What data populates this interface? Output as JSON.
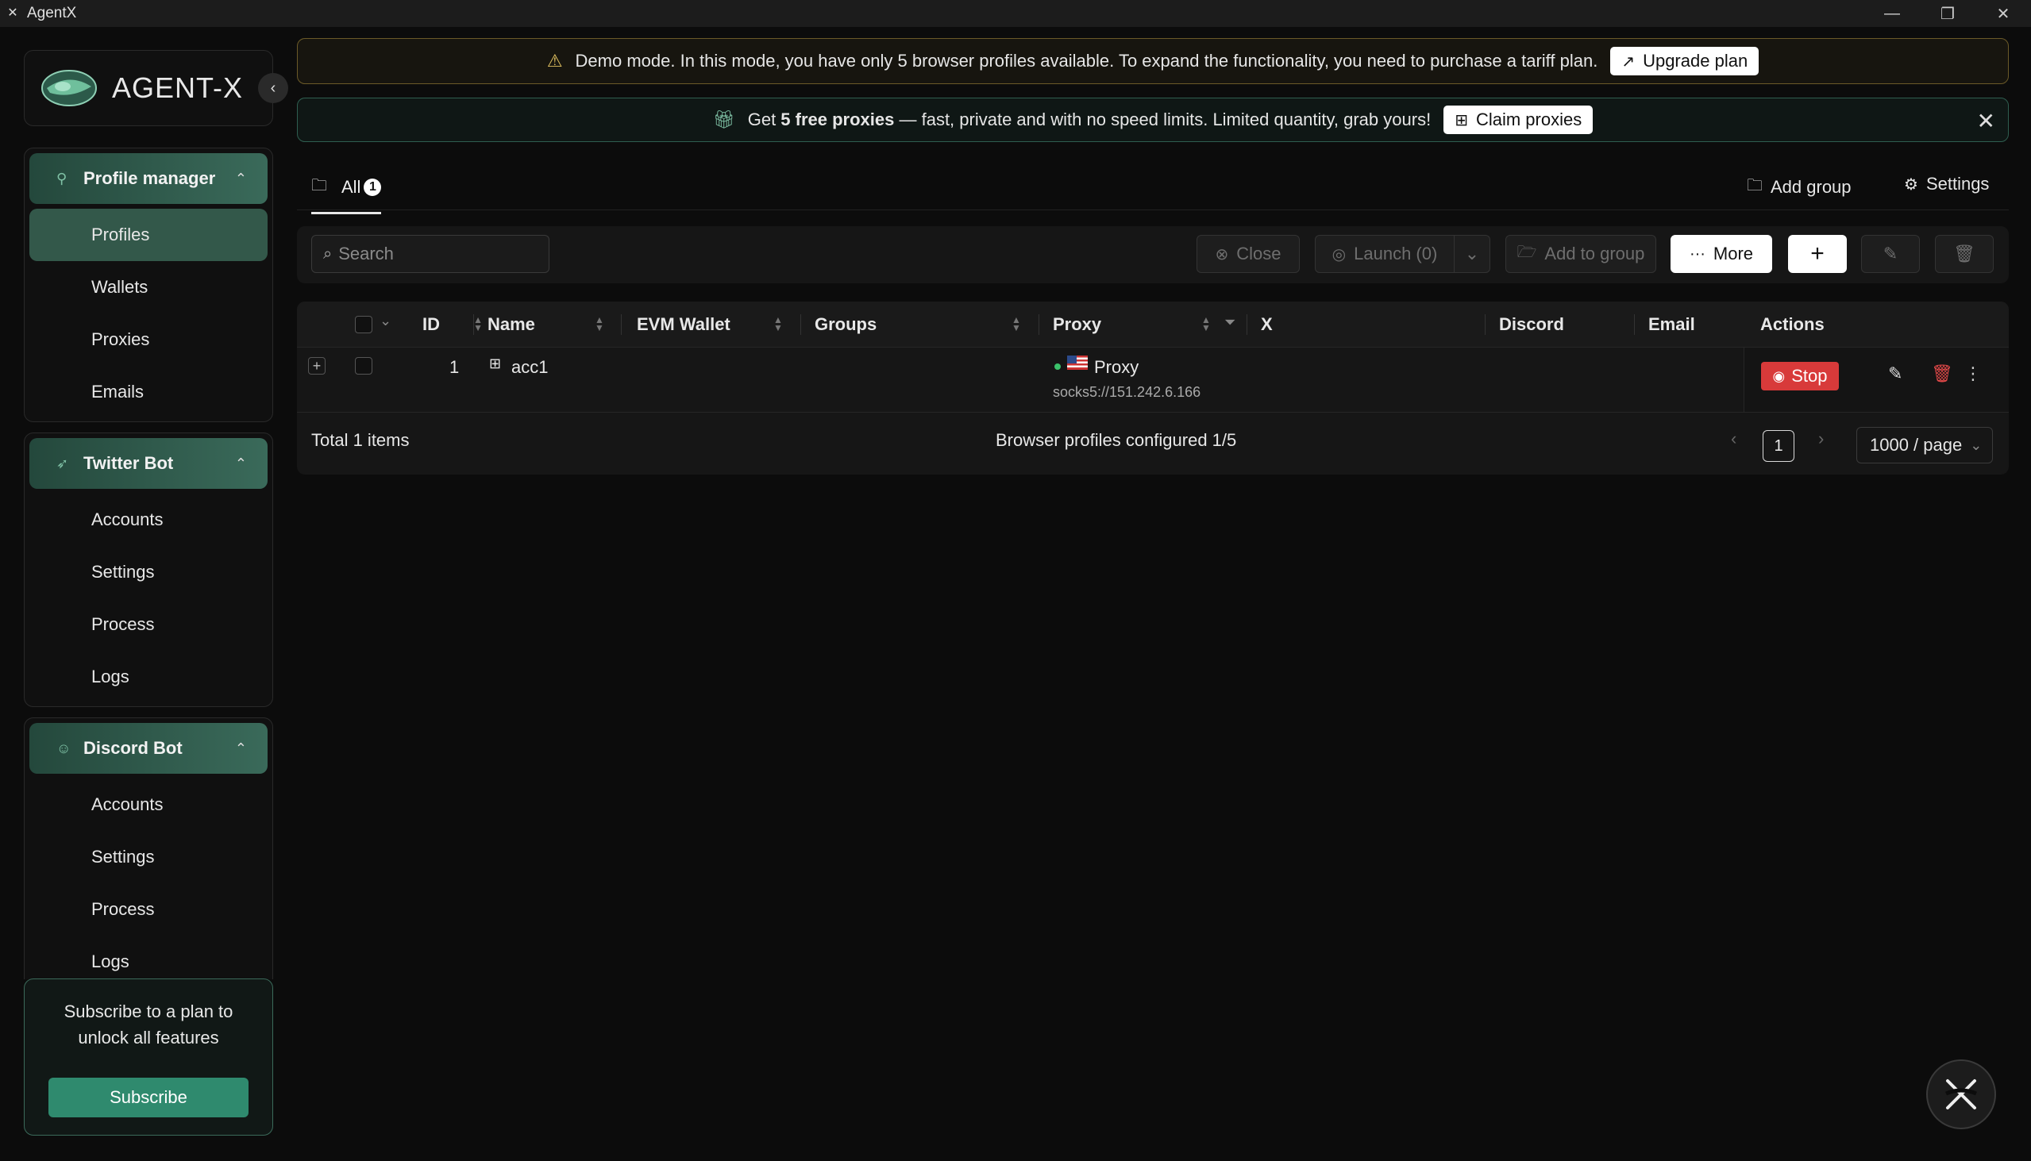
{
  "window": {
    "title": "AgentX"
  },
  "brand": {
    "name": "AGENT-X"
  },
  "sidebar": {
    "sections": [
      {
        "title": "Profile manager",
        "icon": "profile-icon",
        "items": [
          "Profiles",
          "Wallets",
          "Proxies",
          "Emails"
        ],
        "active": "Profiles"
      },
      {
        "title": "Twitter Bot",
        "icon": "twitter-icon",
        "items": [
          "Accounts",
          "Settings",
          "Process",
          "Logs"
        ]
      },
      {
        "title": "Discord Bot",
        "icon": "discord-icon",
        "items": [
          "Accounts",
          "Settings",
          "Process",
          "Logs"
        ]
      }
    ],
    "subscribe": {
      "text": "Subscribe to a plan to unlock all features",
      "button": "Subscribe"
    }
  },
  "banners": {
    "demo": {
      "text": "Demo mode. In this mode, you have only 5 browser profiles available. To expand the functionality, you need to purchase a tariff plan.",
      "button": "Upgrade plan"
    },
    "proxy": {
      "prefix": "Get ",
      "bold": "5 free proxies",
      "suffix": " — fast, private and with no speed limits. Limited quantity, grab yours!",
      "button": "Claim proxies"
    }
  },
  "tabs": {
    "all_label": "All",
    "all_count": "1",
    "add_group": "Add group",
    "settings": "Settings"
  },
  "toolbar": {
    "search_placeholder": "Search",
    "close": "Close",
    "launch": "Launch (0)",
    "add_to_group": "Add to group",
    "more": "More"
  },
  "table": {
    "columns": [
      "ID",
      "Name",
      "EVM Wallet",
      "Groups",
      "Proxy",
      "X",
      "Discord",
      "Email",
      "Actions"
    ],
    "rows": [
      {
        "id": "1",
        "name": "acc1",
        "evm_wallet": "",
        "groups": "",
        "proxy_label": "Proxy",
        "proxy_address": "socks5://151.242.6.166",
        "x": "",
        "discord": "",
        "email": "",
        "action": "Stop"
      }
    ],
    "footer": {
      "total": "Total 1 items",
      "configured": "Browser profiles configured 1/5",
      "page": "1",
      "page_size": "1000 / page"
    }
  },
  "colors": {
    "accent": "#2f8a6e",
    "stop": "#d83a3a",
    "warning_border": "#6b5a28"
  }
}
